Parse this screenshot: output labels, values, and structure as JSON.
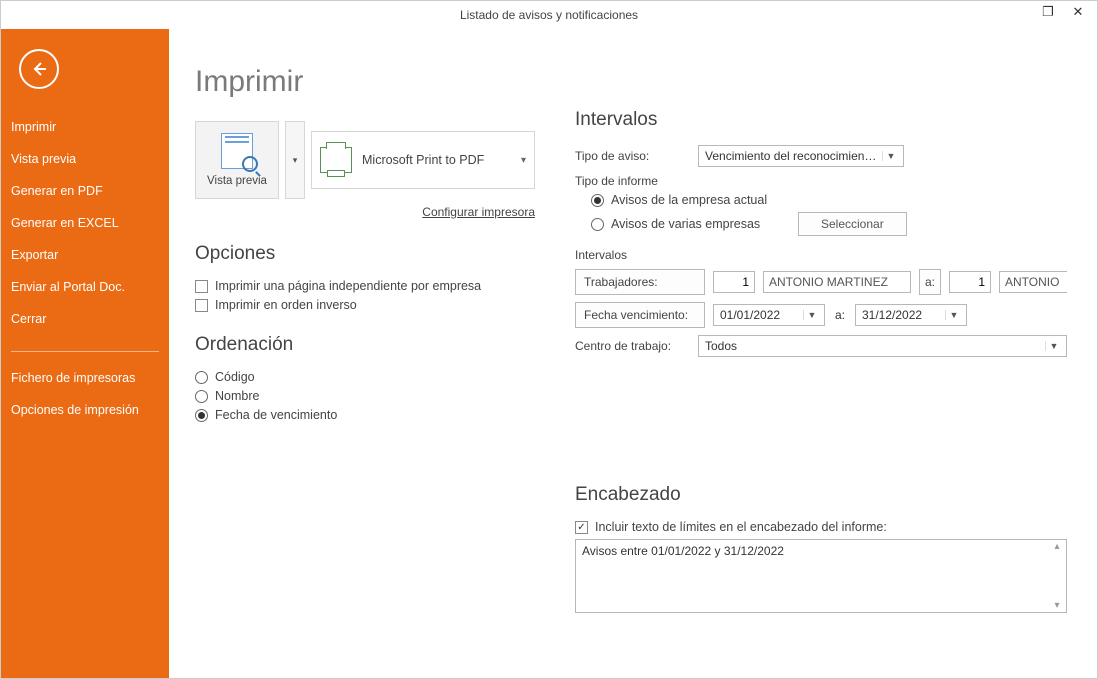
{
  "window": {
    "title": "Listado de avisos y notificaciones"
  },
  "sidebar": {
    "items": [
      "Imprimir",
      "Vista previa",
      "Generar en PDF",
      "Generar en EXCEL",
      "Exportar",
      "Enviar al Portal Doc.",
      "Cerrar"
    ],
    "items2": [
      "Fichero de impresoras",
      "Opciones de impresión"
    ]
  },
  "page": {
    "title": "Imprimir"
  },
  "preview": {
    "label": "Vista previa"
  },
  "printer": {
    "selected": "Microsoft Print to PDF",
    "configure": "Configurar impresora"
  },
  "opciones": {
    "heading": "Opciones",
    "chk_independiente": "Imprimir una página independiente por empresa",
    "chk_inverso": "Imprimir en orden inverso"
  },
  "ordenacion": {
    "heading": "Ordenación",
    "codigo": "Código",
    "nombre": "Nombre",
    "fecha": "Fecha de vencimiento"
  },
  "intervalos": {
    "heading": "Intervalos",
    "tipo_aviso_label": "Tipo de aviso:",
    "tipo_aviso_value": "Vencimiento del reconocimiento m",
    "tipo_informe_label": "Tipo de informe",
    "radio_actual": "Avisos de la empresa actual",
    "radio_varias": "Avisos de varias empresas",
    "seleccionar": "Seleccionar",
    "sub_heading": "Intervalos",
    "trabajadores_btn": "Trabajadores:",
    "trabajador_from_num": "1",
    "trabajador_from_name": "ANTONIO MARTINEZ JUARI",
    "a": "a:",
    "trabajador_to_num": "1",
    "trabajador_to_name": "ANTONIO MARTINEZ JUARI",
    "fecha_btn": "Fecha vencimiento:",
    "fecha_from": "01/01/2022",
    "fecha_to": "31/12/2022",
    "centro_label": "Centro de trabajo:",
    "centro_value": "Todos"
  },
  "encabezado": {
    "heading": "Encabezado",
    "chk_label": "Incluir texto de límites en el encabezado del informe:",
    "text": "Avisos entre 01/01/2022 y 31/12/2022"
  }
}
